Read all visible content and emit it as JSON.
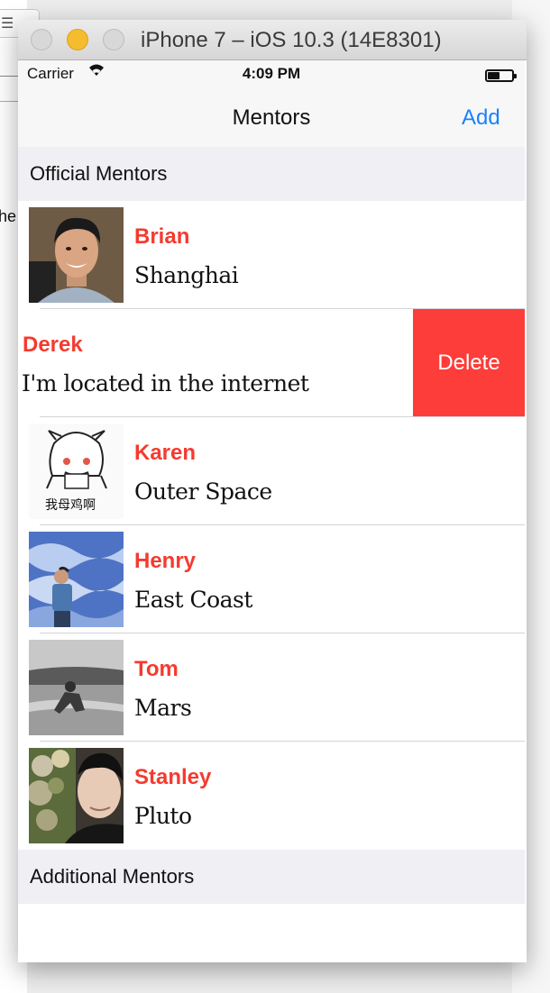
{
  "simulator": {
    "window_title": "iPhone 7 – iOS 10.3 (14E8301)"
  },
  "status_bar": {
    "carrier": "Carrier",
    "time": "4:09 PM"
  },
  "nav_bar": {
    "title": "Mentors",
    "add_label": "Add"
  },
  "sections": [
    {
      "header": "Official Mentors",
      "rows": [
        {
          "name": "Brian",
          "location": "Shanghai"
        },
        {
          "name": "Derek",
          "location": "I'm located in the internet",
          "delete_label": "Delete"
        },
        {
          "name": "Karen",
          "location": "Outer Space",
          "avatar_caption": "我母鸡啊"
        },
        {
          "name": "Henry",
          "location": "East Coast"
        },
        {
          "name": "Tom",
          "location": "Mars"
        },
        {
          "name": "Stanley",
          "location": "Pluto"
        }
      ]
    },
    {
      "header": "Additional Mentors",
      "rows": []
    }
  ],
  "background_fragment": "he",
  "colors": {
    "name_red": "#f43b2f",
    "delete_red": "#fc3d39",
    "link_blue": "#1a82fb",
    "section_bg": "#efeff4"
  }
}
